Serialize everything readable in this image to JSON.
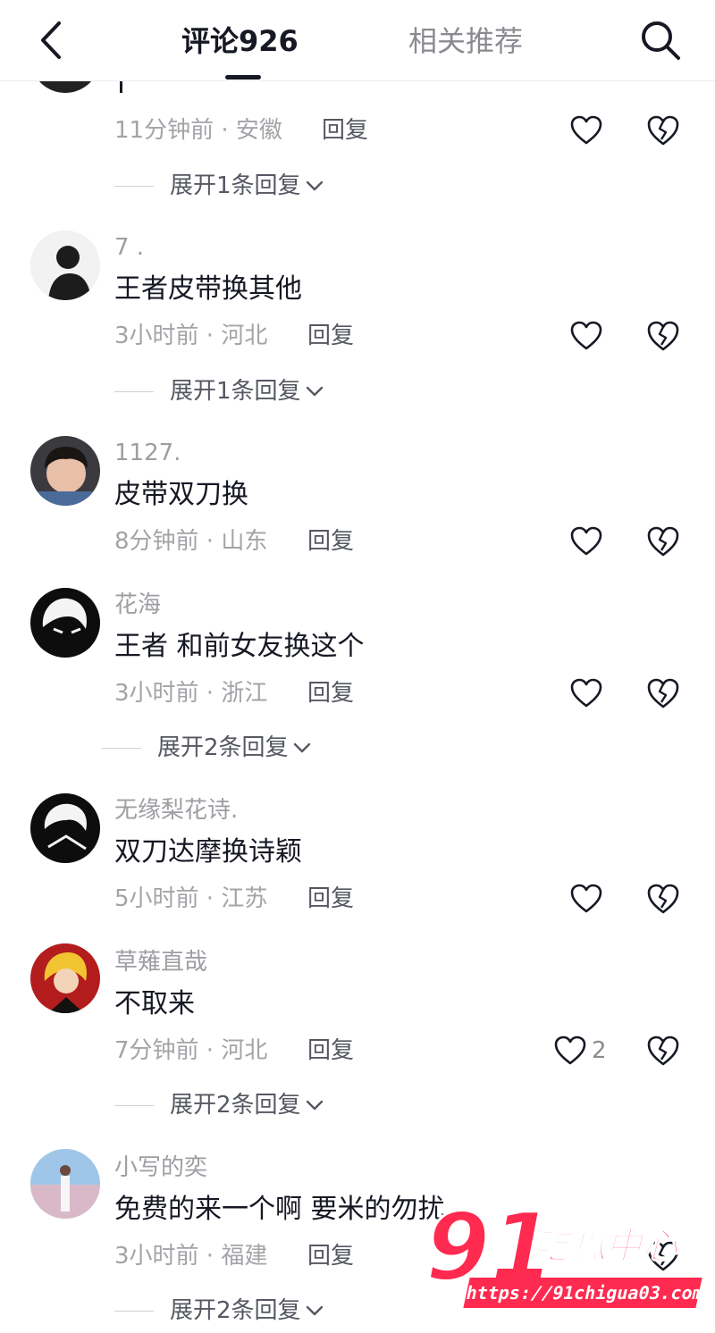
{
  "header": {
    "back_icon": "chevron-left-icon",
    "tab_comments": "评论926",
    "tab_related": "相关推荐",
    "search_icon": "search-icon"
  },
  "colors": {
    "text": "#161823",
    "muted": "#a3a4a8",
    "accent_watermark": "#ff2a4f"
  },
  "comments": [
    {
      "username": "",
      "content": "",
      "time": "11分钟前",
      "location": "安徽",
      "reply": "回复",
      "likes": "",
      "expand": "展开1条回复"
    },
    {
      "username": "7 .",
      "content": "王者皮带换其他",
      "time": "3小时前",
      "location": "河北",
      "reply": "回复",
      "likes": "",
      "expand": "展开1条回复"
    },
    {
      "username": "1127.",
      "content": "皮带双刀换",
      "time": "8分钟前",
      "location": "山东",
      "reply": "回复",
      "likes": "",
      "expand": ""
    },
    {
      "username": "花海",
      "content": "王者 和前女友换这个",
      "time": "3小时前",
      "location": "浙江",
      "reply": "回复",
      "likes": "",
      "expand": "展开2条回复"
    },
    {
      "username": "无缘梨花诗.",
      "content": "双刀达摩换诗颖",
      "time": "5小时前",
      "location": "江苏",
      "reply": "回复",
      "likes": "",
      "expand": ""
    },
    {
      "username": "草薙直哉",
      "content": "不取来",
      "time": "7分钟前",
      "location": "河北",
      "reply": "回复",
      "likes": "2",
      "expand": "展开2条回复"
    },
    {
      "username": "小写的奕",
      "content": "免费的来一个啊 要米的勿扰",
      "time": "3小时前",
      "location": "福建",
      "reply": "回复",
      "likes": "",
      "expand": "展开2条回复"
    }
  ],
  "watermark": {
    "number": "91",
    "title": "吃瓜中心",
    "url": "https://91chigua03.com"
  }
}
